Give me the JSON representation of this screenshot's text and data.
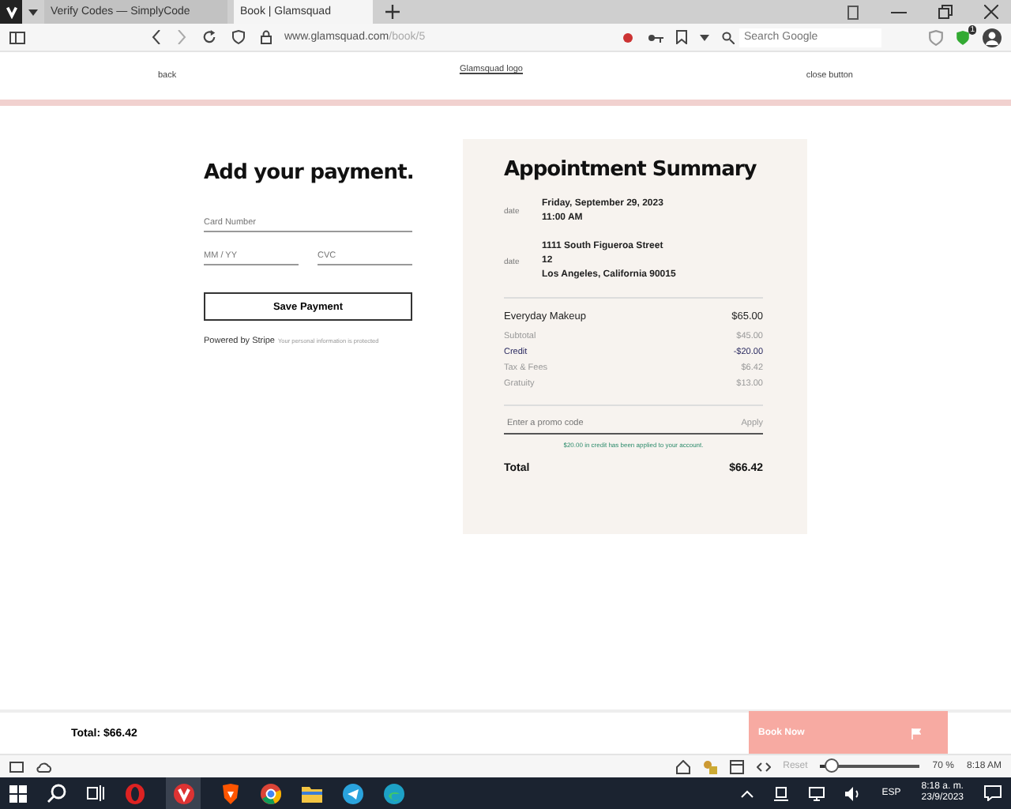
{
  "browser": {
    "tabs": [
      {
        "title": "Verify Codes — SimplyCode",
        "selected": false
      },
      {
        "title": "Book | Glamsquad",
        "selected": true
      }
    ],
    "url_host": "www.glamsquad.com",
    "url_path": "/book/5",
    "search_placeholder": "Search Google",
    "extension_badge": "1"
  },
  "header": {
    "back_alt": "back",
    "logo_alt": "Glamsquad logo",
    "close_alt": "close button"
  },
  "payment": {
    "title": "Add your payment.",
    "card_placeholder": "Card Number",
    "expiry_placeholder": "MM / YY",
    "cvc_placeholder": "CVC",
    "save_button": "Save Payment",
    "stripe_alt": "Powered by Stripe",
    "secure_note": "Your personal information is protected"
  },
  "summary": {
    "title": "Appointment Summary",
    "details": [
      {
        "icon_alt": "date",
        "lines": [
          "Friday, September 29, 2023",
          "11:00 AM"
        ]
      },
      {
        "icon_alt": "date",
        "lines": [
          "1111 South Figueroa Street",
          "12",
          "Los Angeles, California 90015"
        ]
      }
    ],
    "service": {
      "label": "Everyday Makeup",
      "amount": "$65.00"
    },
    "lines": [
      {
        "label": "Subtotal",
        "amount": "$45.00",
        "kind": "plain"
      },
      {
        "label": "Credit",
        "amount": "-$20.00",
        "kind": "credit"
      },
      {
        "label": "Tax & Fees",
        "amount": "$6.42",
        "kind": "plain"
      },
      {
        "label": "Gratuity",
        "amount": "$13.00",
        "kind": "plain"
      }
    ],
    "promo_placeholder": "Enter a promo code",
    "apply": "Apply",
    "credit_note": "$20.00 in credit has been applied to your account.",
    "total_label": "Total",
    "total": "$66.42"
  },
  "footer": {
    "total": "Total: $66.42",
    "book_button": "Book Now",
    "book_disabled": true
  },
  "status_bar": {
    "reset": "Reset",
    "zoom": {
      "level": 0.12
    },
    "zoom_label": "70 %",
    "time": "8:18 AM"
  },
  "taskbar": {
    "language": "ESP",
    "time": "8:18 a. m.",
    "date": "23/9/2023"
  }
}
